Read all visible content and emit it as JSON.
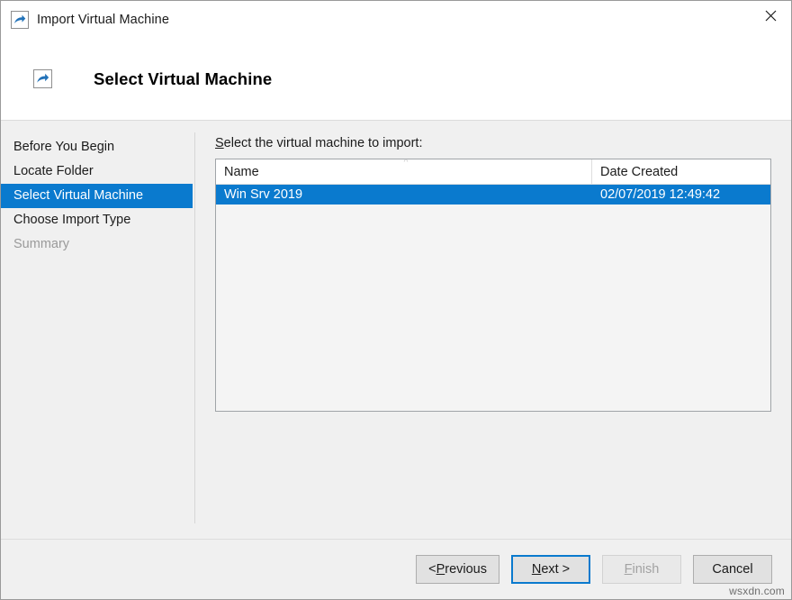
{
  "window": {
    "title": "Import Virtual Machine",
    "icon": "import-vm-icon",
    "close_label": "✕"
  },
  "header": {
    "title": "Select Virtual Machine",
    "icon": "import-vm-icon"
  },
  "sidebar": {
    "items": [
      {
        "label": "Before You Begin",
        "state": "normal"
      },
      {
        "label": "Locate Folder",
        "state": "normal"
      },
      {
        "label": "Select Virtual Machine",
        "state": "selected"
      },
      {
        "label": "Choose Import Type",
        "state": "normal"
      },
      {
        "label": "Summary",
        "state": "disabled"
      }
    ]
  },
  "main": {
    "instruction_prefix": "S",
    "instruction_rest": "elect the virtual machine to import:",
    "list": {
      "columns": [
        {
          "key": "name",
          "label": "Name",
          "sorted": true,
          "sort_direction": "ascending"
        },
        {
          "key": "date",
          "label": "Date Created",
          "sorted": false
        }
      ],
      "rows": [
        {
          "name": "Win Srv 2019",
          "date": "02/07/2019 12:49:42",
          "selected": true
        }
      ]
    }
  },
  "footer": {
    "buttons": [
      {
        "id": "previous",
        "prefix": "< ",
        "accesskey": "P",
        "suffix": "revious",
        "state": "enabled"
      },
      {
        "id": "next",
        "prefix": "",
        "accesskey": "N",
        "suffix": "ext >",
        "state": "default"
      },
      {
        "id": "finish",
        "prefix": "",
        "accesskey": "F",
        "suffix": "inish",
        "state": "disabled"
      },
      {
        "id": "cancel",
        "prefix": "",
        "accesskey": "",
        "suffix": "Cancel",
        "state": "enabled"
      }
    ]
  },
  "watermark": {
    "text": "wsxdn.com"
  },
  "colors": {
    "accent": "#0a7ace",
    "window_bg": "#f0f0f0",
    "panel_bg": "#ffffff",
    "disabled_text": "#9a9a9a"
  }
}
